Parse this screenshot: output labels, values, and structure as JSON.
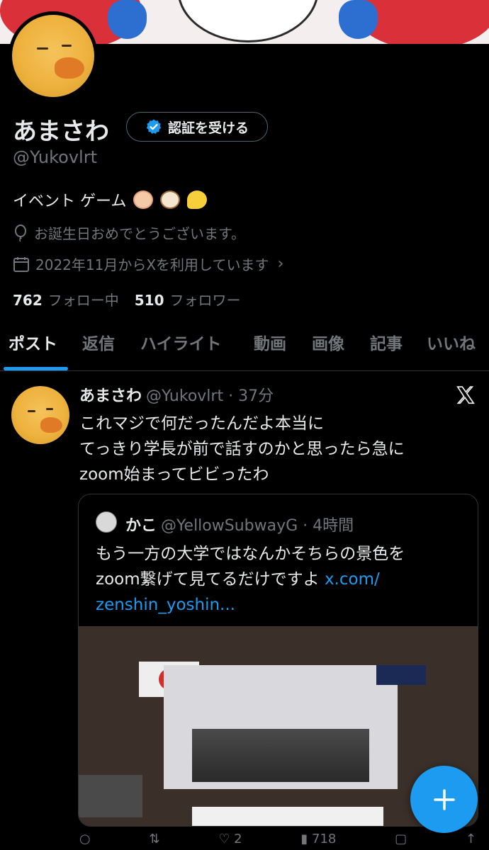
{
  "profile": {
    "name": "あまさわ",
    "verify_label": "認証を受ける",
    "handle": "@Yukovlrt",
    "bio": "イベント ゲーム",
    "birthday": "お誕生日おめでとうございます。",
    "joined": "2022年11月からXを利用しています",
    "following_count": "762",
    "following_label": "フォロー中",
    "followers_count": "510",
    "followers_label": "フォロワー"
  },
  "tabs": [
    {
      "label": "ポスト"
    },
    {
      "label": "返信"
    },
    {
      "label": "ハイライト"
    },
    {
      "label": "動画"
    },
    {
      "label": "画像"
    },
    {
      "label": "記事"
    },
    {
      "label": "いいね"
    }
  ],
  "post": {
    "author": "あまさわ",
    "handle_time": "@Yukovlrt · 37分",
    "text_line1": "これマジで何だったんだよ本当に",
    "text_line2": "てっきり学長が前で話すのかと思ったら急に",
    "text_line3": "zoom始まってビビったわ",
    "quote": {
      "author": "かこ",
      "handle_time": "@YellowSubwayG · 4時間",
      "text_line1": "もう一方の大学ではなんかそちらの景色を",
      "text_line2": "zoom繋げて見てるだけですよ",
      "link_part1": "x.com/",
      "link_part2": "zenshin_yoshin..."
    },
    "actions": {
      "likes": "2",
      "views": "718"
    }
  },
  "colors": {
    "accent": "#1d9bf0",
    "background": "#000000",
    "muted": "#71767b"
  }
}
